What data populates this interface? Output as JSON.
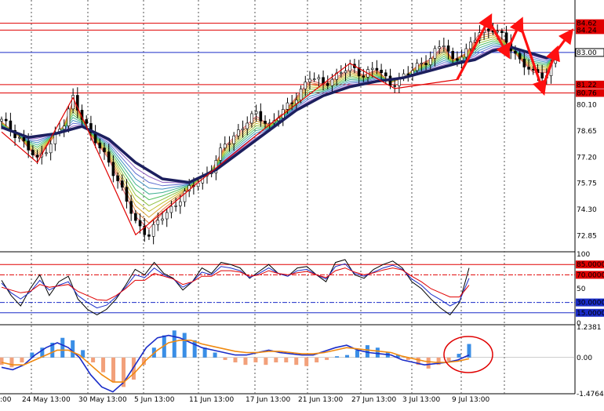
{
  "chart_data": [
    {
      "type": "candlestick",
      "panel": "main",
      "ylim": [
        72.0,
        85.3
      ],
      "price_ticks": [
        "84.62",
        "84.24",
        "83.00",
        "81.22",
        "80.76",
        "80.10",
        "78.65",
        "77.20",
        "75.75",
        "74.30",
        "72.85"
      ],
      "highlight_levels": [
        {
          "label": "84.62",
          "value": 84.62,
          "color": "#e00000"
        },
        {
          "label": "84.24",
          "value": 84.24,
          "color": "#e00000"
        },
        {
          "label": "83.00",
          "value": 83.0,
          "color": "#1a2cc8"
        },
        {
          "label": "81.22",
          "value": 81.22,
          "color": "#e00000"
        },
        {
          "label": "80.76",
          "value": 80.76,
          "color": "#e00000"
        }
      ],
      "x_labels": [
        "24 May 13:00",
        "30 May 13:00",
        "5 Jun 13:00",
        "11 Jun 13:00",
        "17 Jun 13:00",
        "21 Jun 13:00",
        "27 Jun 13:00",
        "3 Jul 13:00",
        "9 Jul 13:00"
      ],
      "x_label_partial": ":00",
      "price_path": [
        [
          0,
          79.2
        ],
        [
          4,
          78.3
        ],
        [
          8,
          77.0
        ],
        [
          12,
          78.4
        ],
        [
          14,
          79.0
        ],
        [
          16,
          80.5
        ],
        [
          18,
          79.5
        ],
        [
          20,
          78.4
        ],
        [
          24,
          77.0
        ],
        [
          27,
          75.3
        ],
        [
          30,
          73.6
        ],
        [
          33,
          72.9
        ],
        [
          36,
          73.9
        ],
        [
          40,
          74.9
        ],
        [
          44,
          75.9
        ],
        [
          47,
          76.5
        ],
        [
          50,
          77.9
        ],
        [
          54,
          78.9
        ],
        [
          57,
          79.6
        ],
        [
          60,
          79.0
        ],
        [
          63,
          79.7
        ],
        [
          66,
          80.6
        ],
        [
          69,
          81.6
        ],
        [
          72,
          81.3
        ],
        [
          75,
          81.7
        ],
        [
          78,
          82.2
        ],
        [
          81,
          81.8
        ],
        [
          84,
          82.1
        ],
        [
          87,
          81.3
        ],
        [
          90,
          81.6
        ],
        [
          93,
          82.3
        ],
        [
          96,
          82.7
        ],
        [
          99,
          83.5
        ],
        [
          101,
          82.6
        ],
        [
          104,
          83.0
        ],
        [
          107,
          84.2
        ],
        [
          110,
          84.3
        ],
        [
          113,
          83.6
        ],
        [
          116,
          82.6
        ],
        [
          119,
          81.8
        ],
        [
          122,
          81.8
        ],
        [
          124,
          82.8
        ]
      ],
      "ma_thick": [
        [
          0,
          78.85
        ],
        [
          6,
          78.3
        ],
        [
          12,
          78.5
        ],
        [
          18,
          78.9
        ],
        [
          24,
          78.2
        ],
        [
          30,
          76.9
        ],
        [
          36,
          76.0
        ],
        [
          42,
          75.8
        ],
        [
          48,
          76.5
        ],
        [
          54,
          77.6
        ],
        [
          60,
          78.7
        ],
        [
          66,
          79.8
        ],
        [
          72,
          80.6
        ],
        [
          78,
          81.1
        ],
        [
          84,
          81.4
        ],
        [
          90,
          81.6
        ],
        [
          96,
          82.0
        ],
        [
          102,
          82.4
        ],
        [
          106,
          82.6
        ],
        [
          110,
          83.1
        ],
        [
          114,
          83.3
        ],
        [
          118,
          83.0
        ],
        [
          122,
          82.7
        ],
        [
          124,
          82.9
        ]
      ],
      "arrows": [
        {
          "from": [
            102,
            81.5
          ],
          "to": [
            109,
            84.8
          ]
        },
        {
          "from": [
            109,
            84.8
          ],
          "to": [
            113,
            83.0
          ]
        },
        {
          "from": [
            113,
            83.0
          ],
          "to": [
            116,
            84.6
          ]
        },
        {
          "from": [
            116,
            84.6
          ],
          "to": [
            121,
            81.0
          ]
        },
        {
          "from": [
            121,
            81.0
          ],
          "to": [
            124,
            83.0
          ]
        },
        {
          "from": [
            124,
            83.0
          ],
          "to": [
            127,
            84.0
          ]
        }
      ]
    },
    {
      "type": "line",
      "panel": "oscillator",
      "ylim": [
        0,
        100
      ],
      "tick_labels": [
        "100",
        "85.0000",
        "70.0000",
        "50",
        "30.0000",
        "15.0000",
        "0"
      ],
      "levels": [
        {
          "label": "85.0000",
          "value": 85,
          "color": "#e00000"
        },
        {
          "label": "70.0000",
          "value": 70,
          "color": "#e00000"
        },
        {
          "label": "30.0000",
          "value": 30,
          "color": "#1a2cc8"
        },
        {
          "label": "15.0000",
          "value": 15,
          "color": "#1a2cc8"
        }
      ],
      "series": [
        {
          "color": "#000000",
          "values": [
            62,
            40,
            25,
            50,
            70,
            40,
            60,
            68,
            35,
            20,
            12,
            20,
            35,
            55,
            78,
            70,
            88,
            72,
            65,
            48,
            60,
            80,
            72,
            88,
            85,
            80,
            65,
            75,
            85,
            72,
            68,
            80,
            82,
            70,
            60,
            88,
            92,
            70,
            65,
            78,
            85,
            90,
            80,
            60,
            50,
            35,
            22,
            12,
            30,
            80
          ]
        },
        {
          "color": "#1a2cc8",
          "values": [
            58,
            44,
            35,
            45,
            62,
            48,
            55,
            60,
            40,
            30,
            22,
            26,
            38,
            52,
            70,
            66,
            80,
            70,
            64,
            52,
            60,
            74,
            70,
            82,
            80,
            76,
            66,
            72,
            80,
            72,
            68,
            76,
            78,
            70,
            64,
            82,
            86,
            72,
            68,
            74,
            80,
            84,
            78,
            64,
            55,
            42,
            34,
            25,
            32,
            65
          ]
        },
        {
          "color": "#e00000",
          "values": [
            52,
            48,
            44,
            46,
            56,
            52,
            54,
            56,
            46,
            40,
            34,
            33,
            40,
            50,
            62,
            62,
            72,
            68,
            64,
            56,
            60,
            68,
            68,
            76,
            76,
            74,
            68,
            70,
            76,
            72,
            70,
            73,
            75,
            70,
            66,
            76,
            80,
            74,
            70,
            73,
            77,
            80,
            77,
            68,
            60,
            50,
            44,
            38,
            38,
            55
          ]
        }
      ]
    },
    {
      "type": "bar",
      "panel": "macd",
      "ylim": [
        -1.4764,
        1.2381
      ],
      "tick_labels": [
        "1.2381",
        "0.00",
        "-1.4764"
      ],
      "histogram": [
        -0.3,
        -0.4,
        -0.2,
        0.2,
        0.4,
        0.6,
        0.8,
        0.7,
        0.3,
        -0.2,
        -0.6,
        -1.0,
        -1.2,
        -0.9,
        -0.3,
        0.4,
        0.9,
        1.1,
        1.0,
        0.7,
        0.4,
        0.2,
        -0.1,
        -0.2,
        -0.3,
        -0.2,
        -0.3,
        -0.2,
        -0.2,
        -0.3,
        -0.35,
        -0.2,
        -0.1,
        0.05,
        0.1,
        0.3,
        0.5,
        0.4,
        0.2,
        0.1,
        -0.1,
        -0.3,
        -0.45,
        -0.3,
        -0.15,
        0.15,
        0.55
      ],
      "series": [
        {
          "color": "#1a2cc8",
          "values": [
            -0.4,
            -0.5,
            -0.3,
            0.1,
            0.4,
            0.6,
            0.4,
            0.0,
            -0.7,
            -1.2,
            -1.4,
            -1.0,
            -0.3,
            0.4,
            0.8,
            0.9,
            0.8,
            0.6,
            0.4,
            0.3,
            0.2,
            0.1,
            0.1,
            0.2,
            0.3,
            0.2,
            0.15,
            0.1,
            0.1,
            0.25,
            0.4,
            0.5,
            0.3,
            0.2,
            0.15,
            0.1,
            -0.1,
            -0.2,
            -0.3,
            -0.25,
            -0.2,
            -0.1,
            0.1
          ]
        },
        {
          "color": "#f08a10",
          "values": [
            -0.2,
            -0.3,
            -0.3,
            -0.1,
            0.1,
            0.3,
            0.3,
            0.1,
            -0.3,
            -0.7,
            -1.0,
            -1.0,
            -0.6,
            -0.1,
            0.3,
            0.6,
            0.7,
            0.7,
            0.55,
            0.45,
            0.35,
            0.25,
            0.2,
            0.2,
            0.25,
            0.25,
            0.2,
            0.15,
            0.15,
            0.2,
            0.3,
            0.4,
            0.35,
            0.3,
            0.25,
            0.2,
            0.05,
            -0.05,
            -0.15,
            -0.2,
            -0.2,
            -0.15,
            -0.05
          ]
        }
      ]
    }
  ]
}
